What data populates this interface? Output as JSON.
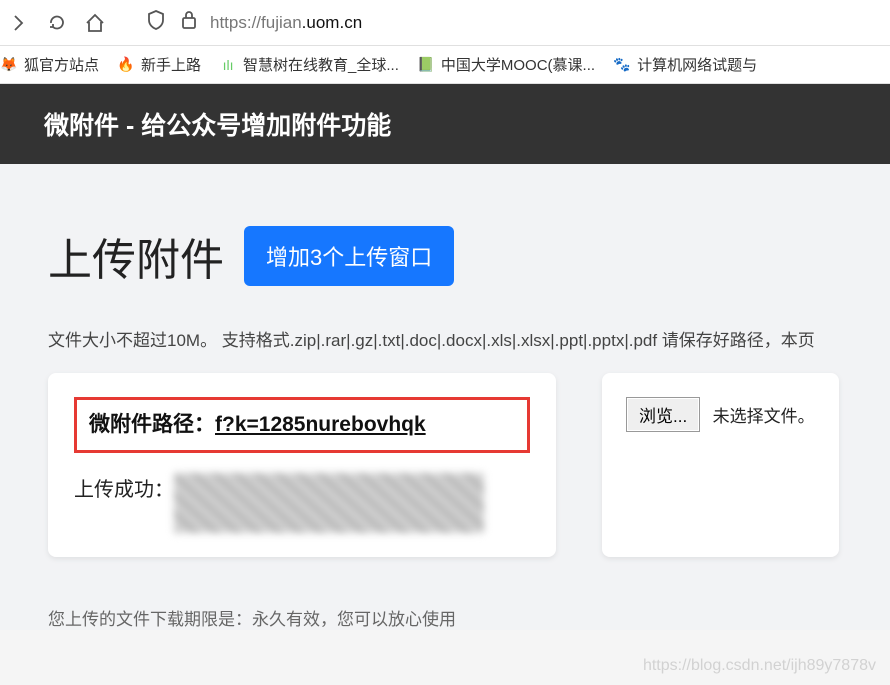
{
  "nav": {
    "url_prefix": "https://fujian",
    "url_suffix": ".uom.cn"
  },
  "bookmarks": [
    {
      "label": "狐官方站点",
      "icon": "sohu"
    },
    {
      "label": "新手上路",
      "icon": "firefox"
    },
    {
      "label": "智慧树在线教育_全球...",
      "icon": "zhihuishu"
    },
    {
      "label": "中国大学MOOC(慕课...",
      "icon": "mooc"
    },
    {
      "label": "计算机网络试题与",
      "icon": "baidu"
    }
  ],
  "header": {
    "title": "微附件 - 给公众号增加附件功能"
  },
  "main": {
    "title": "上传附件",
    "add_button": "增加3个上传窗口",
    "hint": "文件大小不超过10M。 支持格式.zip|.rar|.gz|.txt|.doc|.docx|.xls|.xlsx|.ppt|.pptx|.pdf 请保存好路径，本页"
  },
  "card_left": {
    "path_label": "微附件路径：",
    "path_value": "f?k=1285nurebovhqk",
    "success_label": "上传成功："
  },
  "card_right": {
    "browse_button": "浏览...",
    "no_file": "未选择文件。"
  },
  "footer": {
    "text": "您上传的文件下载期限是：永久有效，您可以放心使用"
  },
  "watermark": "https://blog.csdn.net/ijh89y7878v"
}
